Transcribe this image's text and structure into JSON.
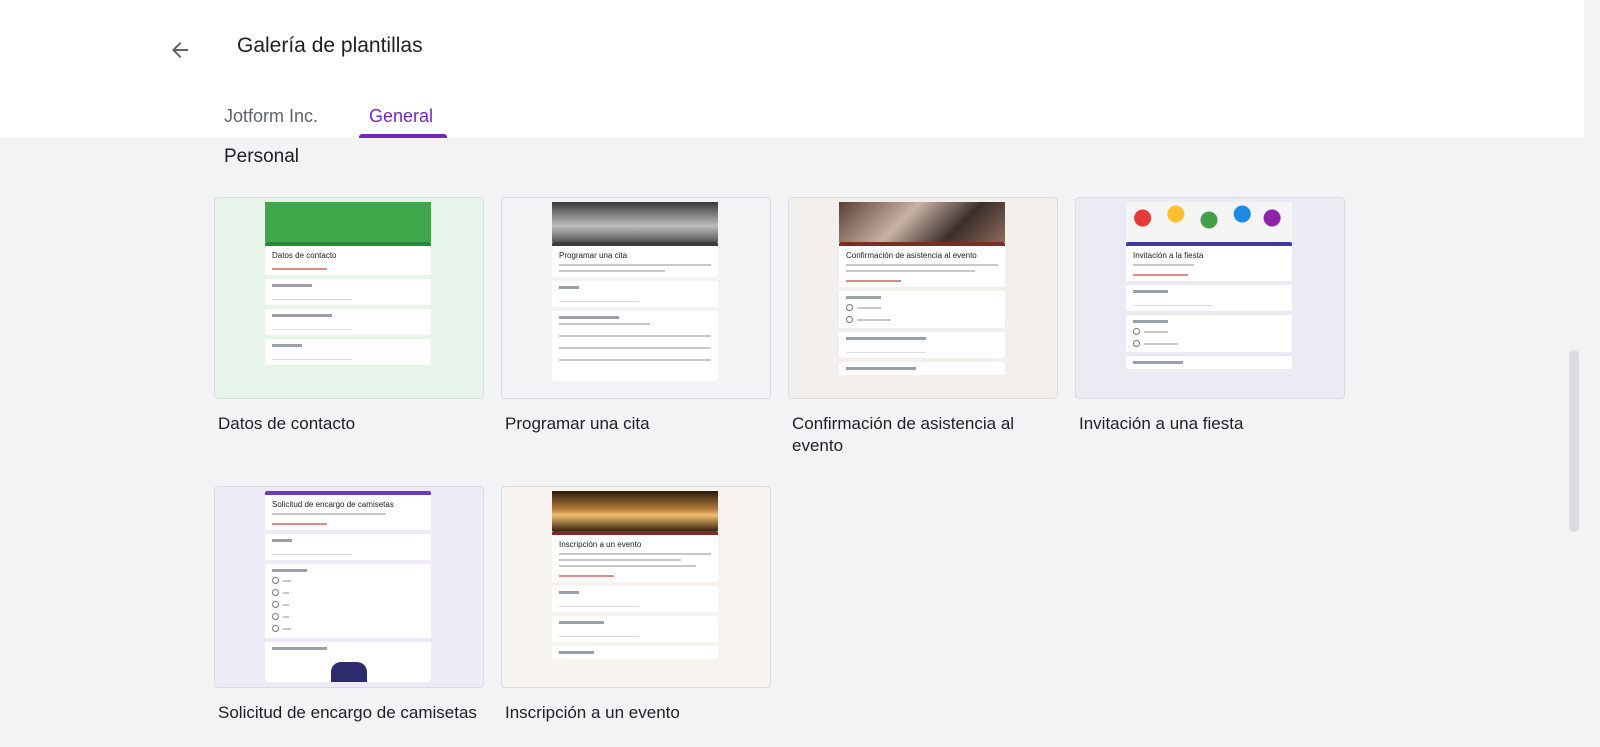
{
  "header": {
    "title": "Galería de plantillas",
    "back_icon": "arrow-back-icon"
  },
  "tabs": [
    {
      "label": "Jotform Inc.",
      "active": false
    },
    {
      "label": "General",
      "active": true
    }
  ],
  "section": {
    "title": "Personal"
  },
  "templates": [
    {
      "title": "Datos de contacto",
      "preview_title": "Datos de contacto",
      "background": "#e6f4ea",
      "header_color": "#3fa74a",
      "accent": "#1e8e3e"
    },
    {
      "title": "Programar una cita",
      "preview_title": "Programar una cita",
      "background": "#f1f3f4",
      "header_color": "#8c8c8c",
      "accent": "#3c3c3c"
    },
    {
      "title": "Confirmación de asistencia al evento",
      "preview_title": "Confirmación de asistencia al evento",
      "background": "#f3efec",
      "header_color": "#6b4a3d",
      "accent": "#7a2f26"
    },
    {
      "title": "Invitación a una fiesta",
      "preview_title": "Invitación a la fiesta",
      "background": "#eceaf3",
      "header_color": "#d35a4b",
      "accent": "#3f3aa0"
    },
    {
      "title": "Solicitud de encargo de camisetas",
      "preview_title": "Solicitud de encargo de camisetas",
      "background": "#efeaf8",
      "header_color": "",
      "accent": "#6a3fbf"
    },
    {
      "title": "Inscripción a un evento",
      "preview_title": "Inscripción a un evento",
      "background": "#f7f3ef",
      "header_color": "#5a3a20",
      "accent": "#7a2f26"
    }
  ]
}
